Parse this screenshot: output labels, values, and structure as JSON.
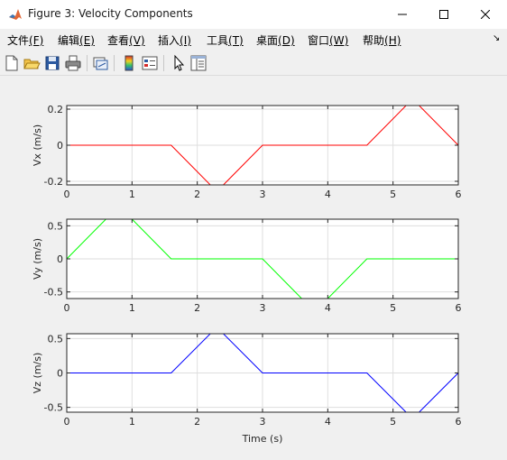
{
  "window": {
    "title": "Figure 3: Velocity Components"
  },
  "menu": [
    {
      "label": "文件",
      "accel": "(F)"
    },
    {
      "label": "编辑",
      "accel": "(E)"
    },
    {
      "label": "查看",
      "accel": "(V)"
    },
    {
      "label": "插入",
      "accel": "(I)"
    },
    {
      "label": "工具",
      "accel": "(T)"
    },
    {
      "label": "桌面",
      "accel": "(D)"
    },
    {
      "label": "窗口",
      "accel": "(W)"
    },
    {
      "label": "帮助",
      "accel": "(H)"
    }
  ],
  "toolbar": {
    "buttons": [
      "new-figure-icon",
      "open-file-icon",
      "save-icon",
      "print-icon",
      "link-plot-icon",
      "colorbar-icon",
      "legend-icon",
      "pointer-icon",
      "property-inspector-icon"
    ]
  },
  "colors": {
    "vx": "#ff0000",
    "vy": "#00ff00",
    "vz": "#0000ff",
    "grid": "#dedede"
  },
  "chart_data": [
    {
      "type": "line",
      "ylabel": "Vx (m/s)",
      "xlabel": "",
      "xlim": [
        0,
        6
      ],
      "ylim": [
        -0.22,
        0.22
      ],
      "xticks": [
        "0",
        "1",
        "2",
        "3",
        "4",
        "5",
        "6"
      ],
      "yticks": [
        "0.2",
        "0",
        "-0.2"
      ],
      "yticks_values": [
        0.2,
        0,
        -0.2
      ],
      "grid": true,
      "series": [
        {
          "color": "#ff0000",
          "x": [
            0,
            1.6,
            2.2,
            2.4,
            3.0,
            4.6,
            5.2,
            5.4,
            6.0
          ],
          "y": [
            0,
            0,
            -0.22,
            -0.22,
            0,
            0,
            0.22,
            0.22,
            0
          ]
        }
      ]
    },
    {
      "type": "line",
      "ylabel": "Vy (m/s)",
      "xlabel": "",
      "xlim": [
        0,
        6
      ],
      "ylim": [
        -0.6,
        0.6
      ],
      "xticks": [
        "0",
        "1",
        "2",
        "3",
        "4",
        "5",
        "6"
      ],
      "yticks": [
        "0.5",
        "0",
        "-0.5"
      ],
      "yticks_values": [
        0.5,
        0,
        -0.5
      ],
      "grid": true,
      "series": [
        {
          "color": "#00ff00",
          "x": [
            0,
            0.6,
            1.0,
            1.6,
            3.0,
            3.6,
            4.0,
            4.6,
            6.0
          ],
          "y": [
            0,
            0.6,
            0.6,
            0,
            0,
            -0.6,
            -0.6,
            0,
            0
          ]
        }
      ]
    },
    {
      "type": "line",
      "ylabel": "Vz (m/s)",
      "xlabel": "Time (s)",
      "xlim": [
        0,
        6
      ],
      "ylim": [
        -0.57,
        0.57
      ],
      "xticks": [
        "0",
        "1",
        "2",
        "3",
        "4",
        "5",
        "6"
      ],
      "yticks": [
        "0.5",
        "0",
        "-0.5"
      ],
      "yticks_values": [
        0.5,
        0,
        -0.5
      ],
      "grid": true,
      "series": [
        {
          "color": "#0000ff",
          "x": [
            0,
            1.6,
            2.2,
            2.4,
            3.0,
            4.6,
            5.2,
            5.4,
            6.0
          ],
          "y": [
            0,
            0,
            0.57,
            0.57,
            0,
            0,
            -0.57,
            -0.57,
            0
          ]
        }
      ]
    }
  ]
}
